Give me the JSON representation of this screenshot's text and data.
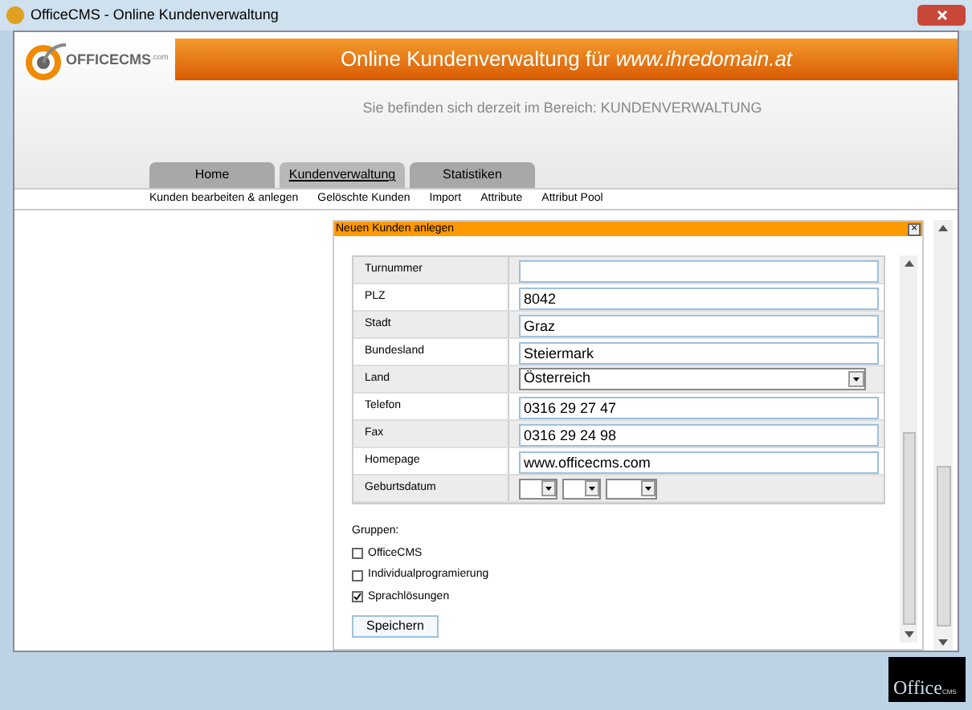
{
  "window": {
    "title": "OfficeCMS - Online Kundenverwaltung"
  },
  "header": {
    "logo": {
      "name": "OFFICECMS",
      "suffix": ".com"
    },
    "title": "Online Kundenverwaltung für ",
    "domain": "www.ihredomain.at",
    "location": "Sie befinden sich derzeit im Bereich: KUNDENVERWALTUNG"
  },
  "tabs": [
    {
      "label": "Home",
      "selected": false
    },
    {
      "label": "Kundenverwaltung",
      "selected": true
    },
    {
      "label": "Statistiken",
      "selected": false
    }
  ],
  "submenu": [
    "Kunden bearbeiten & anlegen",
    "Gelöschte Kunden",
    "Import",
    "Attribute",
    "Attribut Pool"
  ],
  "dialog": {
    "title": "Neuen Kunden anlegen",
    "close": "×",
    "rows": [
      {
        "label": "Turnummer",
        "kind": "text",
        "value": ""
      },
      {
        "label": "PLZ",
        "kind": "text",
        "value": "8042"
      },
      {
        "label": "Stadt",
        "kind": "text",
        "value": "Graz"
      },
      {
        "label": "Bundesland",
        "kind": "text",
        "value": "Steiermark"
      },
      {
        "label": "Land",
        "kind": "select",
        "value": "Österreich"
      },
      {
        "label": "Telefon",
        "kind": "text",
        "value": "0316 29 27 47"
      },
      {
        "label": "Fax",
        "kind": "text",
        "value": "0316 29 24 98"
      },
      {
        "label": "Homepage",
        "kind": "text",
        "value": "www.officecms.com"
      },
      {
        "label": "Geburtsdatum",
        "kind": "date",
        "value": ""
      }
    ],
    "groups_label": "Gruppen:",
    "groups": [
      {
        "label": "OfficeCMS",
        "checked": false
      },
      {
        "label": "Individualprogramierung",
        "checked": false
      },
      {
        "label": "Sprachlösungen",
        "checked": true
      }
    ],
    "save": "Speichern"
  },
  "footer_logo": {
    "name": "Office",
    "suffix": "CMS"
  }
}
